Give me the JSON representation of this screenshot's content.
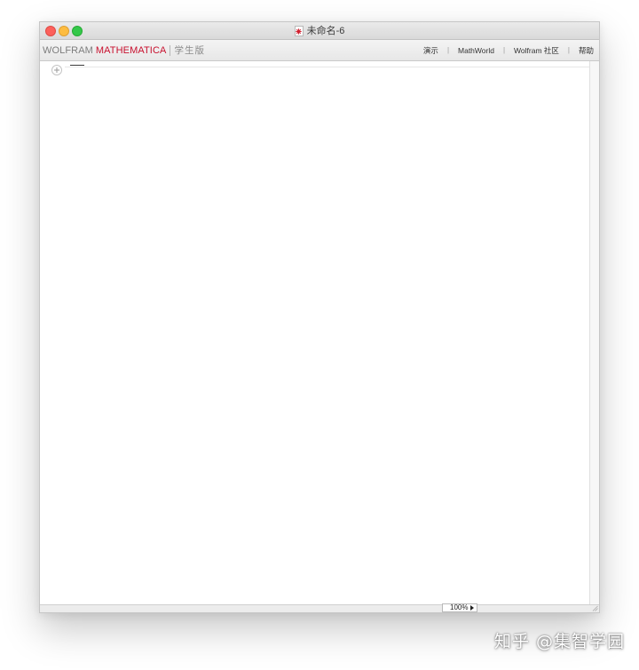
{
  "window": {
    "title": "未命名-6",
    "controls": {
      "close": "close-button",
      "minimize": "minimize-button",
      "maximize": "maximize-button"
    },
    "icon": "notebook-document-icon"
  },
  "brand": {
    "wolfram": "WOLFRAM",
    "mathematica": "MATHEMATICA",
    "edition": "学生版",
    "accent_color": "#c8102e"
  },
  "nav": {
    "items": [
      {
        "label": "演示"
      },
      {
        "label": "MathWorld"
      },
      {
        "label": "Wolfram 社区"
      },
      {
        "label": "帮助"
      }
    ],
    "separator": "|"
  },
  "notebook": {
    "insert_cell_icon": "plus-circle-icon"
  },
  "statusbar": {
    "zoom": "100%"
  },
  "watermark": {
    "text": "知乎 @集智学园"
  }
}
